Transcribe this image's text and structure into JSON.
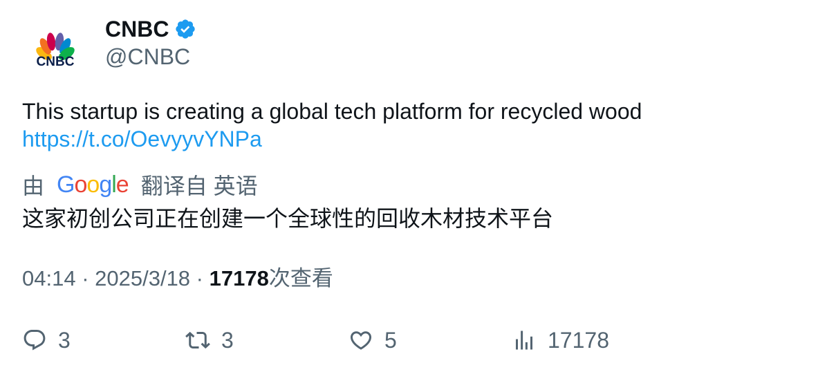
{
  "author": {
    "display_name": "CNBC",
    "handle": "@CNBC",
    "avatar_logo_text": "CNBC",
    "verified": true
  },
  "tweet": {
    "text": "This startup is creating a global tech platform for recycled wood",
    "link": "https://t.co/OevyyvYNPa"
  },
  "translation": {
    "prefix": "由",
    "provider": "Google",
    "suffix": "翻译自 英语",
    "text": "这家初创公司正在创建一个全球性的回收木材技术平台"
  },
  "meta": {
    "time": "04:14",
    "separator1": " · ",
    "date": "2025/3/18",
    "separator2": " · ",
    "views_count": "17178",
    "views_label": "次查看"
  },
  "actions": {
    "replies": "3",
    "retweets": "3",
    "likes": "5",
    "views": "17178"
  },
  "colors": {
    "link": "#1d9bf0",
    "secondary_text": "#536471",
    "primary_text": "#0f1419",
    "verified_badge": "#1d9bf0"
  },
  "icons": {
    "reply": "reply-icon",
    "retweet": "retweet-icon",
    "like": "heart-icon",
    "views": "bar-chart-icon",
    "verified": "verified-badge-icon"
  }
}
